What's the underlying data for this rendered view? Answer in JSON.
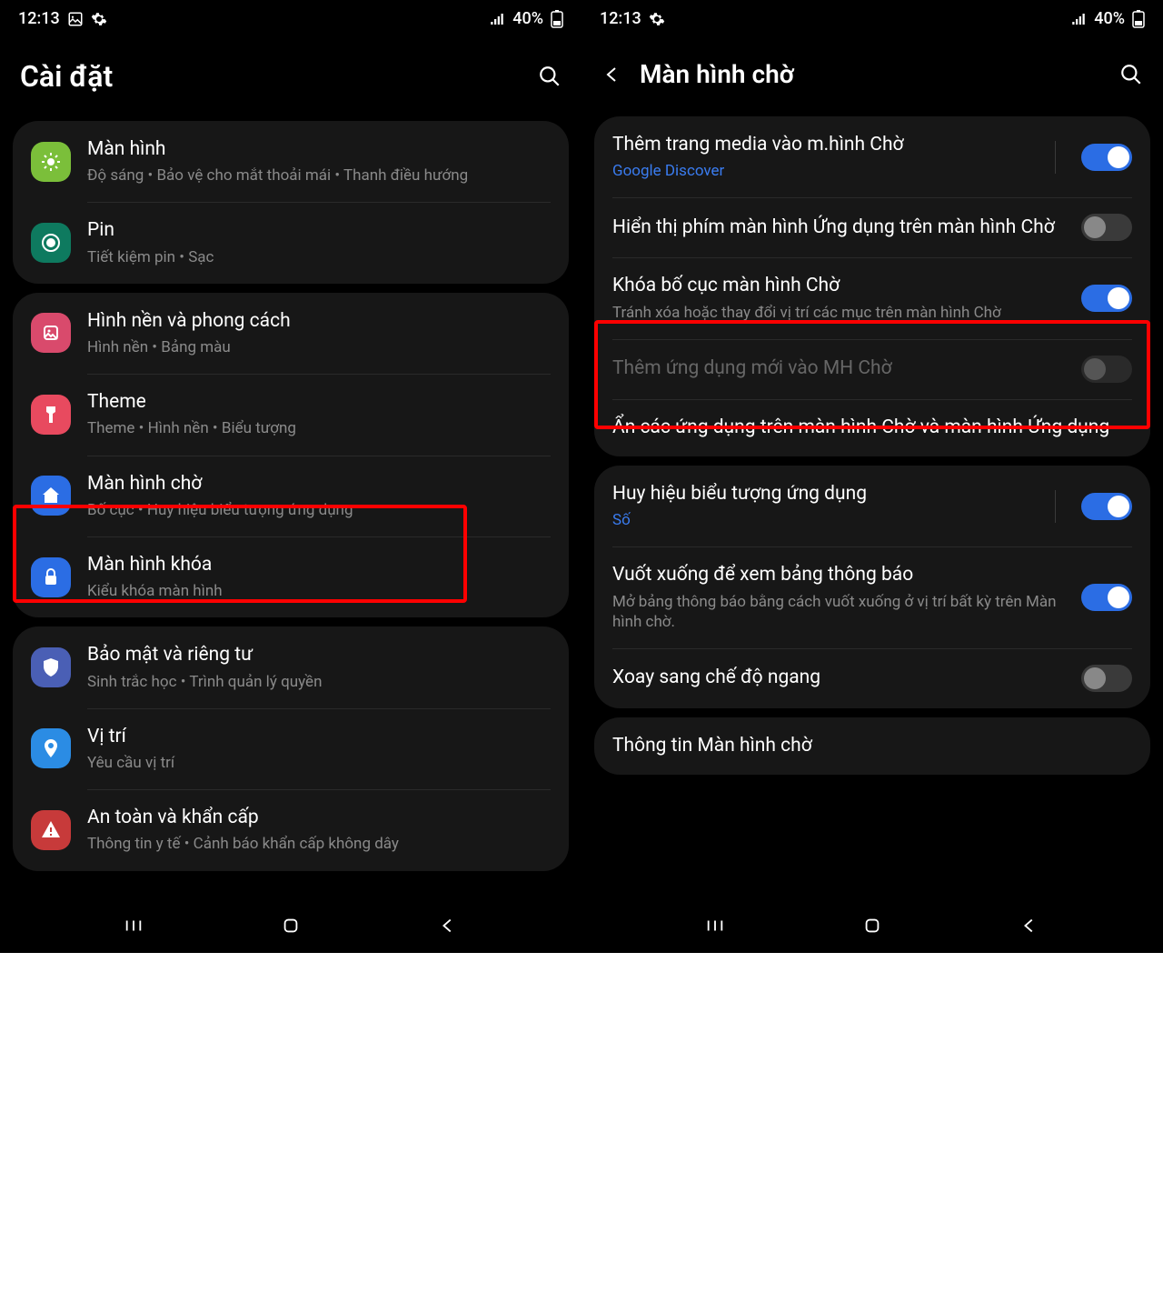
{
  "status": {
    "time": "12:13",
    "battery": "40%"
  },
  "left": {
    "title": "Cài đặt",
    "groups": [
      [
        {
          "icon": "display",
          "color": "#7bbf3a",
          "title": "Màn hình",
          "sub": "Độ sáng  •  Bảo vệ cho mắt thoải mái  •  Thanh điều hướng"
        },
        {
          "icon": "battery",
          "color": "#0e7a5f",
          "title": "Pin",
          "sub": "Tiết kiệm pin  •  Sạc"
        }
      ],
      [
        {
          "icon": "wallpaper",
          "color": "#d94a6c",
          "title": "Hình nền và phong cách",
          "sub": "Hình nền  •  Bảng màu"
        },
        {
          "icon": "theme",
          "color": "#e84a5f",
          "title": "Theme",
          "sub": "Theme  •  Hình nền  •  Biểu tượng"
        },
        {
          "icon": "home",
          "color": "#2b6de4",
          "title": "Màn hình chờ",
          "sub": "Bố cục  •  Huy hiệu biểu tượng ứng dụng"
        },
        {
          "icon": "lock",
          "color": "#2b6de4",
          "title": "Màn hình khóa",
          "sub": "Kiểu khóa màn hình"
        }
      ],
      [
        {
          "icon": "shield",
          "color": "#4a5fb5",
          "title": "Bảo mật và riêng tư",
          "sub": "Sinh trắc học  •  Trình quản lý quyền"
        },
        {
          "icon": "location",
          "color": "#2b8ce4",
          "title": "Vị trí",
          "sub": "Yêu cầu vị trí"
        },
        {
          "icon": "emergency",
          "color": "#c73a3a",
          "title": "An toàn và khẩn cấp",
          "sub": "Thông tin y tế  •  Cảnh báo khẩn cấp không dây"
        }
      ]
    ]
  },
  "right": {
    "title": "Màn hình chờ",
    "items": [
      {
        "title": "Thêm trang media vào m.hình Chờ",
        "sub": "Google Discover",
        "sublink": true,
        "toggle": "on",
        "vdiv": true
      },
      {
        "title": "Hiển thị phím màn hình Ứng dụng trên màn hình Chờ",
        "toggle": "off"
      },
      {
        "title": "Khóa bố cục màn hình Chờ",
        "sub": "Tránh xóa hoặc thay đổi vị trí các mục trên màn hình Chờ",
        "toggle": "on"
      },
      {
        "title": "Thêm ứng dụng mới vào MH Chờ",
        "toggle": "disabled",
        "disabled": true
      },
      {
        "title": "Ẩn các ứng dụng trên màn hình Chờ và màn hình Ứng dụng"
      },
      {
        "title": "Huy hiệu biểu tượng ứng dụng",
        "sub": "Số",
        "sublink": true,
        "toggle": "on",
        "vdiv": true
      },
      {
        "title": "Vuốt xuống để xem bảng thông báo",
        "sub": "Mở bảng thông báo bằng cách vuốt xuống ở vị trí bất kỳ trên Màn hình chờ.",
        "toggle": "on"
      },
      {
        "title": "Xoay sang chế độ ngang",
        "toggle": "off"
      },
      {
        "title": "Thông tin Màn hình chờ"
      }
    ],
    "groups": [
      [
        0,
        1,
        2,
        3,
        4
      ],
      [
        5,
        6,
        7
      ],
      [
        8
      ]
    ]
  }
}
